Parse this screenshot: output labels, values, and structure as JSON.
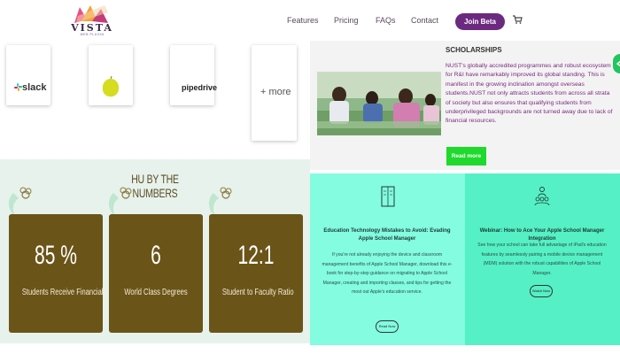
{
  "header": {
    "logo_text": "VISTA",
    "logo_sub": "WEB PLUGIN",
    "nav": [
      "Features",
      "Pricing",
      "FAQs",
      "Contact"
    ],
    "beta_label": "Join Beta",
    "cart_icon": "cart-icon"
  },
  "integrations": {
    "cards": [
      "slack",
      "",
      "pipedrive",
      "+ more"
    ]
  },
  "scholarships": {
    "title": "SCHOLARSHIPS",
    "text": "NUST's globally accredited programmes and robust ecosystem for R&I have remarkably improved its global standing. This is manifest in the growing inclination amongst overseas students.NUST not only attracts students from across all strata of society but also ensures that qualifying students from underprivileged backgrounds are not turned away due to lack of financial resources.",
    "button": "Read more"
  },
  "numbers": {
    "heading": "HU BY THE NUMBERS",
    "stats": [
      {
        "value": "85 %",
        "label": "Students Receive Financial Support"
      },
      {
        "value": "6",
        "label": "World Class Degrees"
      },
      {
        "value": "12:1",
        "label": "Student to Faculty Ratio"
      }
    ]
  },
  "webinars": [
    {
      "title": "Education Technology Mistakes to Avoid: Evading Apple School Manager",
      "text": "If you're not already enjoying the device and classroom management benefits of Apple School Manager, download this e-book for step-by-step guidance on migrating to Apple School Manager, creating and importing classes, and tips for getting the most out Apple's education service.",
      "button": "Read Now"
    },
    {
      "title": "Webinar: How to Ace Your Apple School Manager Integration",
      "text": "See how your school can take full advantage of iPad's education features by seamlessly pairing a mobile device management (MDM) solution with the robust capabilities of Apple School Manager.",
      "button": "Watch Now"
    }
  ],
  "colors": {
    "brand_purple": "#6b2a7f",
    "green_button": "#1fd92c",
    "stat_brown": "#6a5418",
    "mint_light": "#83fce0",
    "mint": "#55f0c5"
  }
}
